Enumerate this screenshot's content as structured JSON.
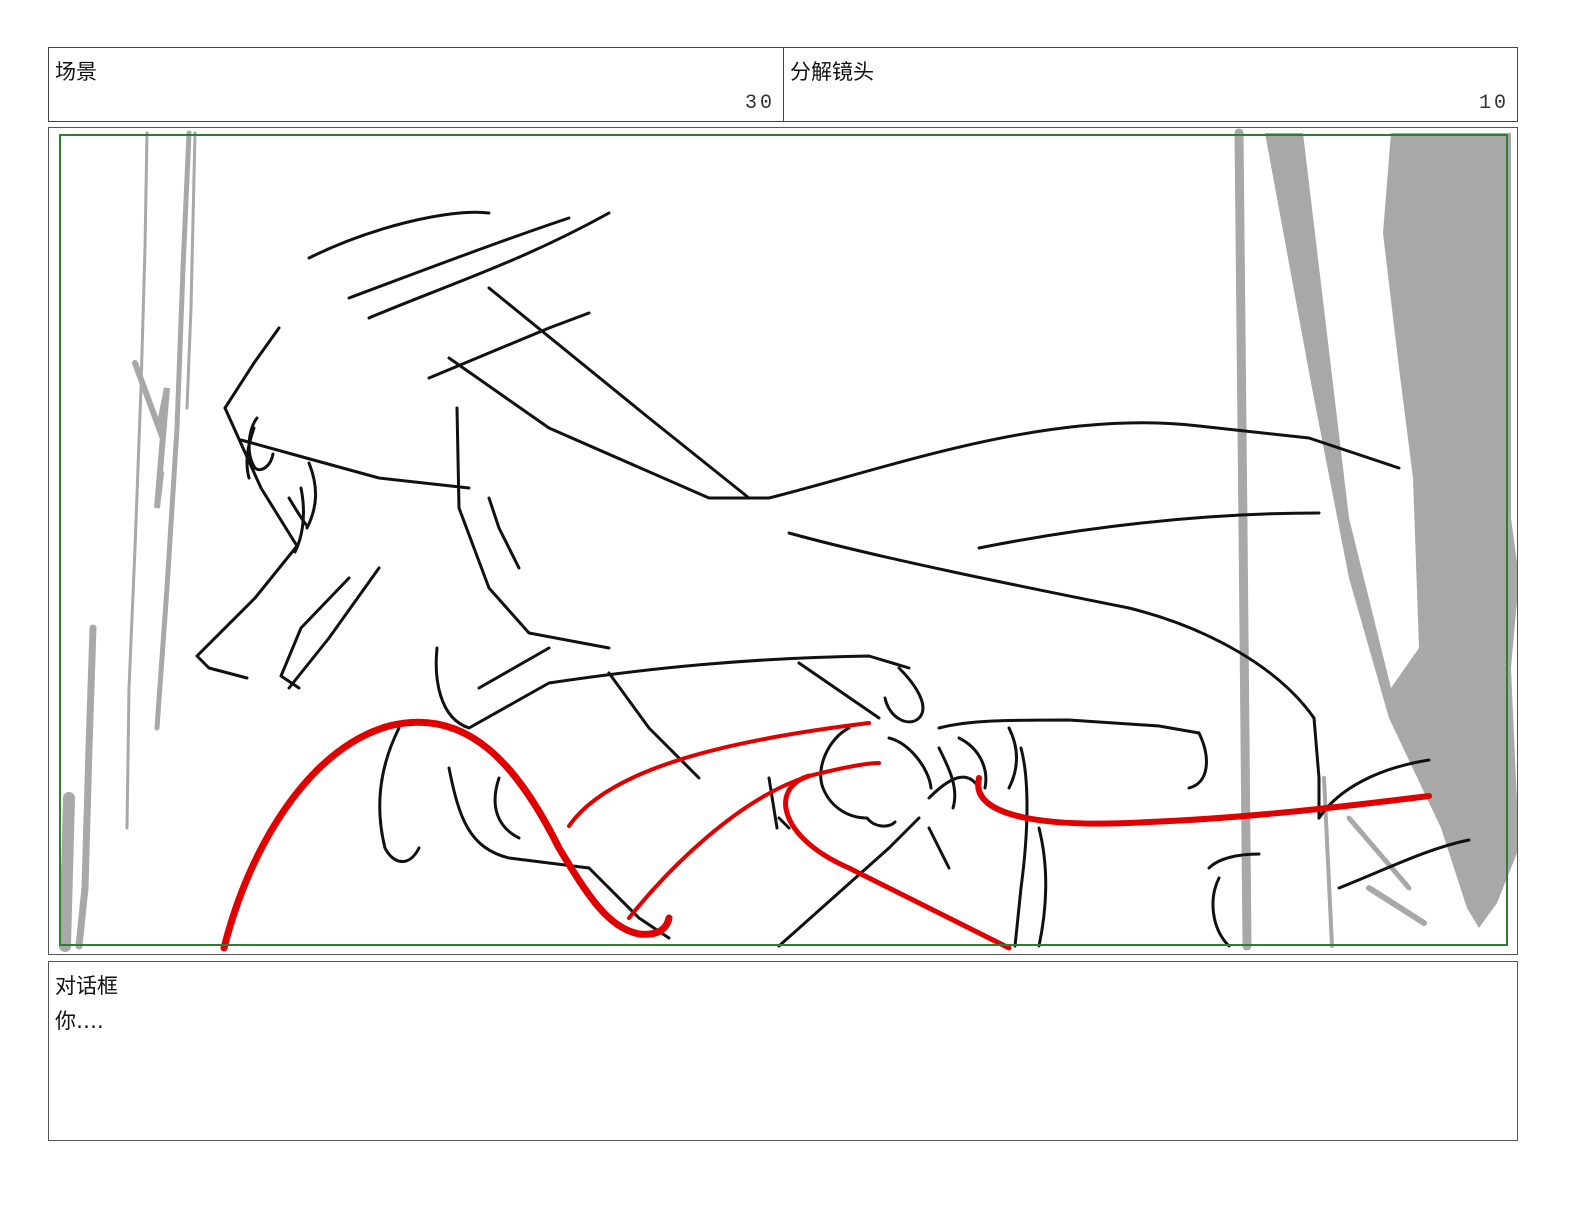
{
  "header": {
    "scene_label": "场景",
    "scene_number": "30",
    "shot_label": "分解镜头",
    "shot_number": "10"
  },
  "panel": {
    "safe_frame_color": "#2e7d32",
    "rough_color": "#a8a8a8",
    "line_color": "#111111",
    "accent_color": "#e00000"
  },
  "dialog": {
    "label": "对话框",
    "text": "你….",
    "lines": [
      "你…."
    ]
  }
}
